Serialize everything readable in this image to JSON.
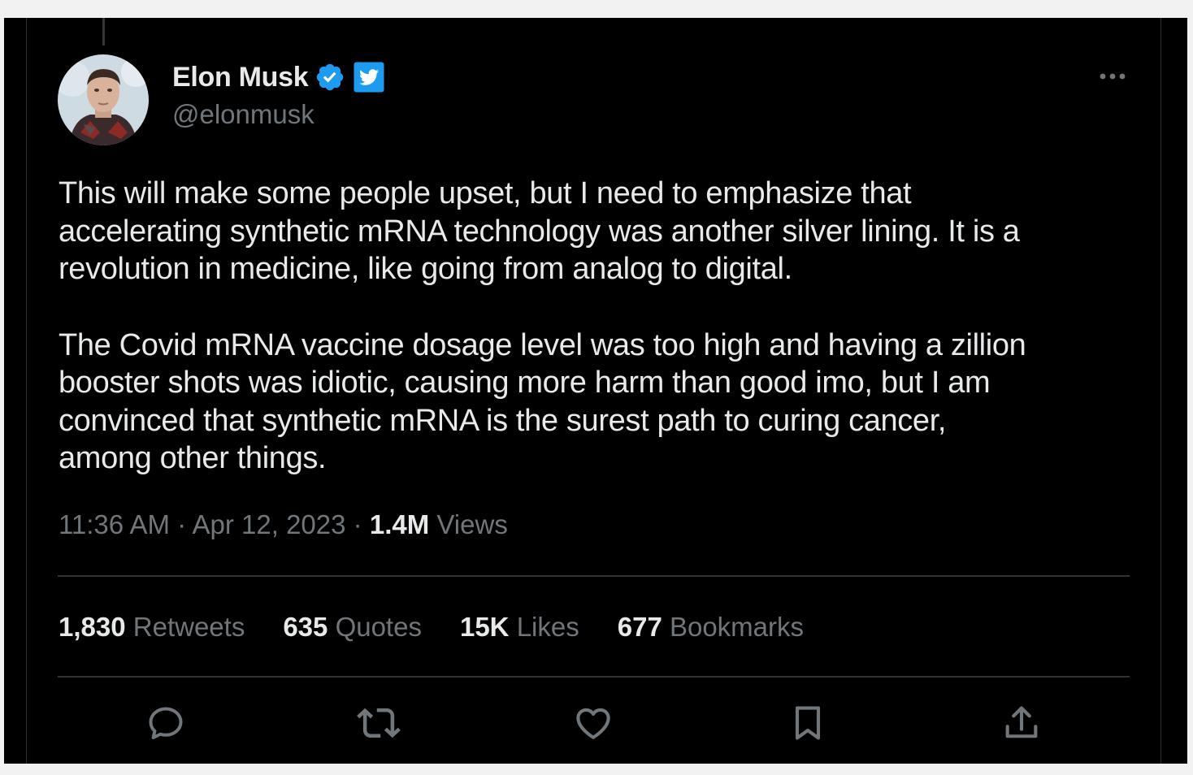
{
  "author": {
    "display_name": "Elon Musk",
    "handle": "@elonmusk",
    "verified_icon": "verified-badge-icon",
    "affiliate_icon": "twitter-bird-icon"
  },
  "tweet": {
    "paragraphs": [
      "This will make some people upset, but I need to emphasize that\naccelerating synthetic mRNA technology was another silver lining. It is a\nrevolution in medicine, like going from analog to digital.",
      "The Covid mRNA vaccine dosage level was too high and having a zillion\nbooster shots was idiotic, causing more harm than good imo, but I am\nconvinced that synthetic mRNA is the surest path to curing cancer,\namong other things."
    ]
  },
  "meta": {
    "time": "11:36 AM",
    "separator": "·",
    "date": "Apr 12, 2023",
    "views_count": "1.4M",
    "views_label": "Views"
  },
  "stats": {
    "retweets": {
      "count": "1,830",
      "label": "Retweets"
    },
    "quotes": {
      "count": "635",
      "label": "Quotes"
    },
    "likes": {
      "count": "15K",
      "label": "Likes"
    },
    "bookmarks": {
      "count": "677",
      "label": "Bookmarks"
    }
  },
  "actions": [
    "reply-icon",
    "retweet-icon",
    "like-icon",
    "bookmark-icon",
    "share-icon"
  ],
  "colors": {
    "background": "#000000",
    "text_primary": "#e7e9ea",
    "text_secondary": "#71767b",
    "divider": "#2f3336",
    "verified_blue": "#1d9bf0"
  }
}
